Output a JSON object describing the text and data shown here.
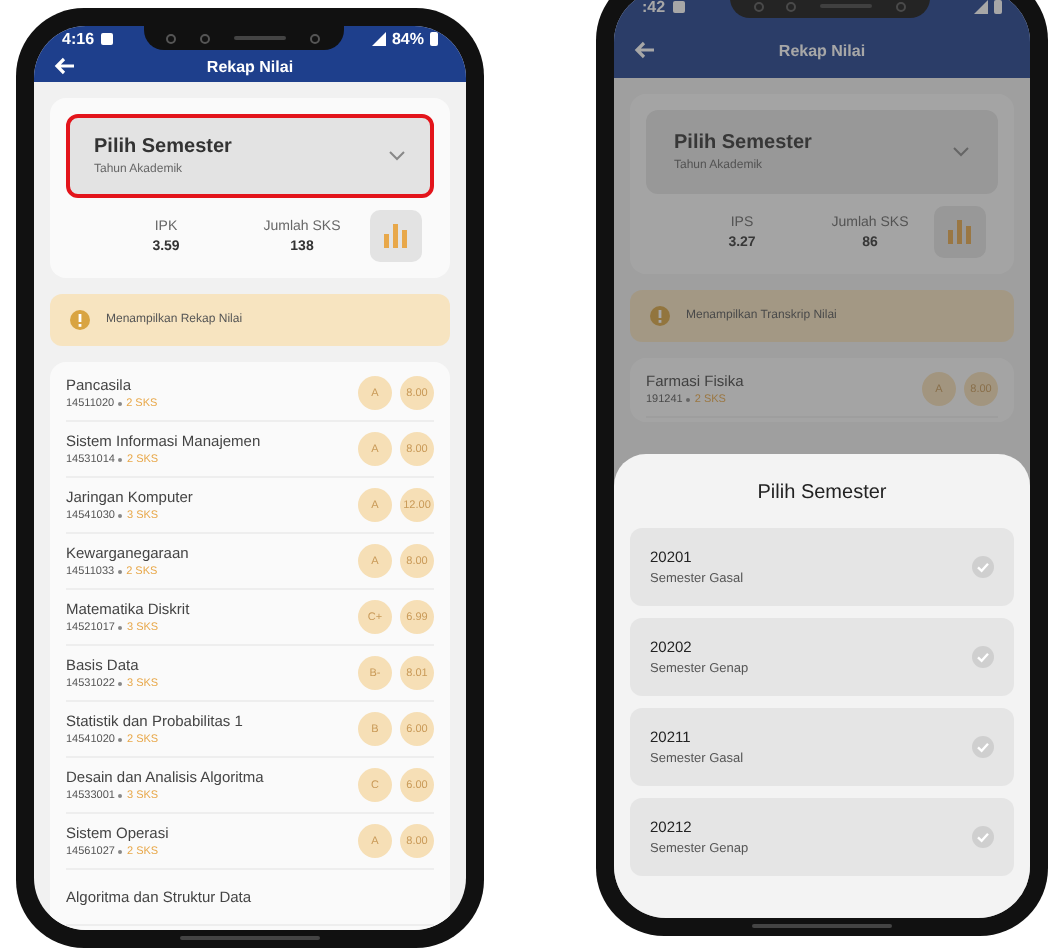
{
  "phones": [
    {
      "status": {
        "time": "4:16",
        "battery": "84%"
      },
      "title": "Rekap Nilai",
      "selector": {
        "title": "Pilih Semester",
        "subtitle": "Tahun Akademik",
        "highlighted": true
      },
      "stats": [
        {
          "label": "IPK",
          "value": "3.59"
        },
        {
          "label": "Jumlah SKS",
          "value": "138"
        }
      ],
      "notice": "Menampilkan Rekap Nilai",
      "courses": [
        {
          "name": "Pancasila",
          "code": "14511020",
          "sks": "2 SKS",
          "grade": "A",
          "score": "8.00"
        },
        {
          "name": "Sistem Informasi Manajemen",
          "code": "14531014",
          "sks": "2 SKS",
          "grade": "A",
          "score": "8.00"
        },
        {
          "name": "Jaringan Komputer",
          "code": "14541030",
          "sks": "3 SKS",
          "grade": "A",
          "score": "12.00"
        },
        {
          "name": "Kewarganegaraan",
          "code": "14511033",
          "sks": "2 SKS",
          "grade": "A",
          "score": "8.00"
        },
        {
          "name": "Matematika Diskrit",
          "code": "14521017",
          "sks": "3 SKS",
          "grade": "C+",
          "score": "6.99"
        },
        {
          "name": "Basis Data",
          "code": "14531022",
          "sks": "3 SKS",
          "grade": "B-",
          "score": "8.01"
        },
        {
          "name": "Statistik dan Probabilitas 1",
          "code": "14541020",
          "sks": "2 SKS",
          "grade": "B",
          "score": "6.00"
        },
        {
          "name": "Desain dan Analisis Algoritma",
          "code": "14533001",
          "sks": "3 SKS",
          "grade": "C",
          "score": "6.00"
        },
        {
          "name": "Sistem Operasi",
          "code": "14561027",
          "sks": "2 SKS",
          "grade": "A",
          "score": "8.00"
        },
        {
          "name": "Algoritma dan Struktur Data"
        }
      ]
    },
    {
      "status": {
        "time": ":42"
      },
      "title": "Rekap Nilai",
      "selector": {
        "title": "Pilih Semester",
        "subtitle": "Tahun Akademik",
        "highlighted": false
      },
      "stats": [
        {
          "label": "IPS",
          "value": "3.27"
        },
        {
          "label": "Jumlah SKS",
          "value": "86"
        }
      ],
      "notice": "Menampilkan Transkrip Nilai",
      "courses": [
        {
          "name": "Farmasi Fisika",
          "code": "191241",
          "sks": "2 SKS",
          "grade": "A",
          "score": "8.00"
        }
      ],
      "sheet": {
        "title": "Pilih Semester",
        "options": [
          {
            "code": "20201",
            "name": "Semester Gasal",
            "selected": false
          },
          {
            "code": "20202",
            "name": "Semester Genap",
            "selected": false
          },
          {
            "code": "20211",
            "name": "Semester Gasal",
            "selected": false
          },
          {
            "code": "20212",
            "name": "Semester Genap",
            "selected": false
          }
        ]
      }
    }
  ]
}
